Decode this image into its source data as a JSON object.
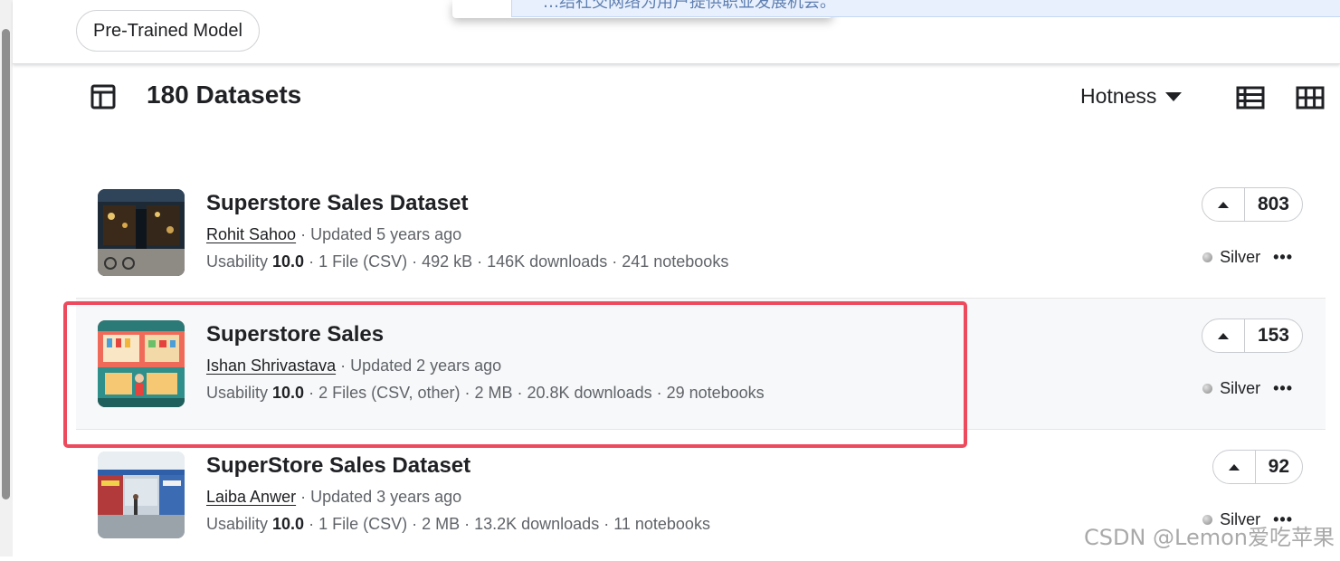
{
  "filter_chip": {
    "label": "Pre-Trained Model"
  },
  "popup": {
    "text": "…结社交网络为用户提供职业发展机会。"
  },
  "header": {
    "count_label": "180 Datasets",
    "sort_label": "Hotness"
  },
  "datasets": [
    {
      "title": "Superstore Sales Dataset",
      "author": "Rohit Sahoo",
      "updated": " · Updated 5 years ago",
      "usability_label": "Usability ",
      "usability": "10.0",
      "details": " · 1 File (CSV) · 492 kB · 146K downloads · 241 notebooks",
      "votes": "803",
      "medal": "Silver"
    },
    {
      "title": "Superstore Sales",
      "author": "Ishan Shrivastava",
      "updated": " · Updated 2 years ago",
      "usability_label": "Usability ",
      "usability": "10.0",
      "details": " · 2 Files (CSV, other) · 2 MB · 20.8K downloads · 29 notebooks",
      "votes": "153",
      "medal": "Silver"
    },
    {
      "title": "SuperStore Sales Dataset",
      "author": "Laiba Anwer",
      "updated": " · Updated 3 years ago",
      "usability_label": "Usability ",
      "usability": "10.0",
      "details": " · 1 File (CSV) · 2 MB · 13.2K downloads · 11 notebooks",
      "votes": "92",
      "medal": "Silver"
    }
  ],
  "more_glyph": "•••",
  "watermark": "CSDN @Lemon爱吃苹果",
  "colors": {
    "highlight": "#ee4a5e",
    "medal_silver": "#9e9e9e"
  },
  "icons": [
    "table-icon",
    "list-view-icon",
    "grid-view-icon",
    "upvote-icon",
    "more-icon",
    "silver-medal-icon"
  ]
}
